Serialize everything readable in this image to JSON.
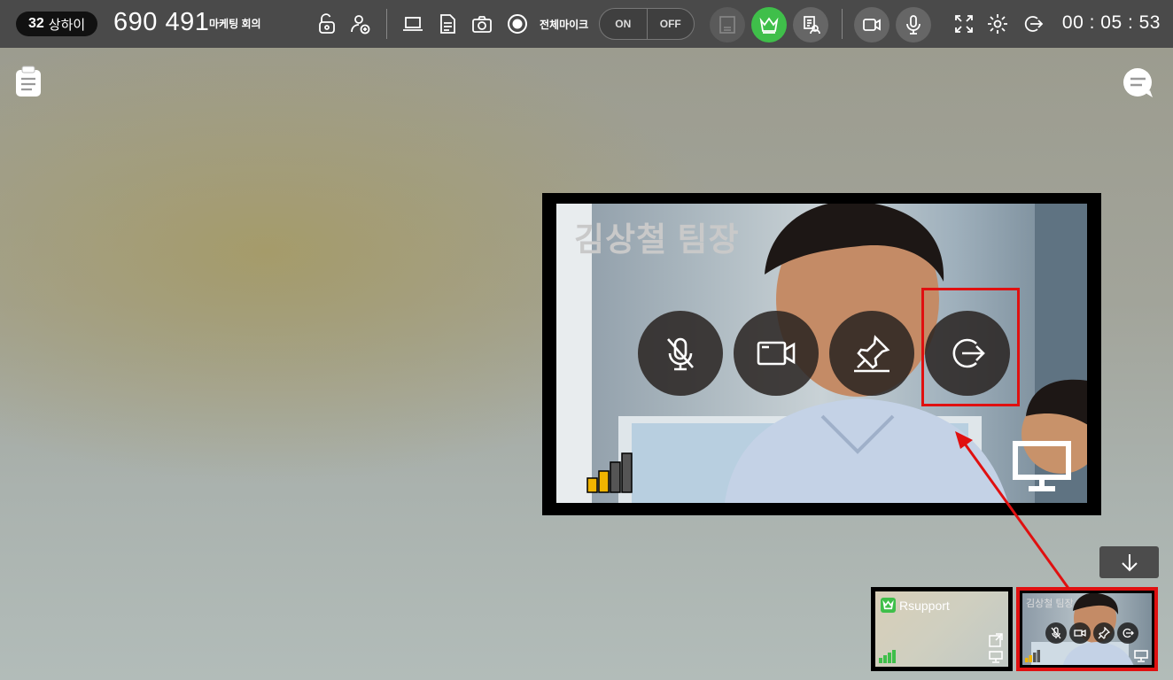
{
  "topbar": {
    "room_number": "32",
    "room_location": "상하이",
    "room_id": "690 491",
    "room_name": "마케팅 회의",
    "all_mic_label": "전체마이크",
    "mic_on_label": "ON",
    "mic_off_label": "OFF",
    "timer": "00 : 05 : 53",
    "icons": [
      "lock-icon",
      "invite-user-icon",
      "screen-share-icon",
      "document-icon",
      "camera-capture-icon",
      "record-icon",
      "layout-icon",
      "crown-icon",
      "participants-list-icon",
      "video-icon",
      "microphone-icon",
      "fullscreen-icon",
      "settings-icon",
      "exit-icon"
    ]
  },
  "stage": {
    "left_icon": "notes-icon",
    "right_icon": "chat-icon"
  },
  "zoom_tile": {
    "participant_name": "김상철 팀장",
    "controls": [
      "mic-muted-icon",
      "video-icon",
      "pin-icon",
      "exit-icon"
    ],
    "highlight_color": "#e01010"
  },
  "thumbnails": [
    {
      "name": "Rsupport",
      "is_host": true
    },
    {
      "name": "김상철 팀장",
      "is_host": false,
      "selected": true
    }
  ],
  "colors": {
    "accent_green": "#3fbf4a",
    "highlight_red": "#e01010",
    "signal_yellow": "#f0b400"
  }
}
